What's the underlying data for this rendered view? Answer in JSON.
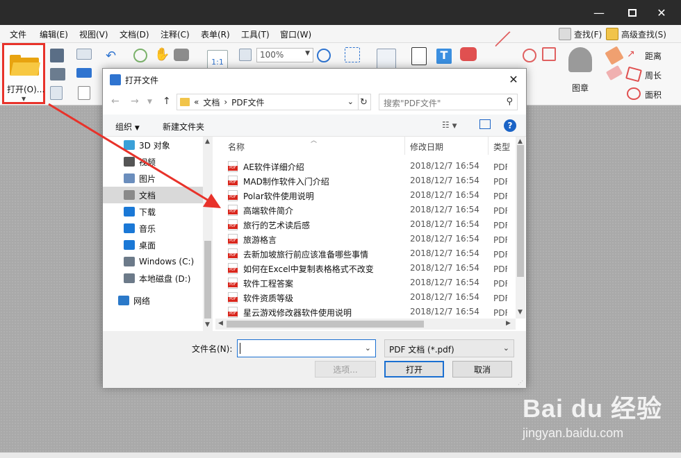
{
  "menu": {
    "items": [
      "文件",
      "编辑(E)",
      "视图(V)",
      "文档(D)",
      "注释(C)",
      "表单(R)",
      "工具(T)",
      "窗口(W)"
    ],
    "search": "查找(F)",
    "advanced_search": "高级查找(S)"
  },
  "ribbon": {
    "open_label": "打开(O)...",
    "zoom_value": "100%",
    "stamp_label": "图章",
    "distance_label": "距离",
    "perimeter_label": "周长",
    "area_label": "面积"
  },
  "dialog": {
    "title": "打开文件",
    "close": "✕",
    "address": {
      "prefix": "«",
      "crumb1": "文档",
      "sep": "›",
      "crumb2": "PDF文件"
    },
    "search_placeholder": "搜索\"PDF文件\"",
    "commands": {
      "organize": "组织",
      "new_folder": "新建文件夹"
    },
    "nav_items": [
      {
        "label": "3D 对象",
        "icon": "3d-objects-icon",
        "color": "#3aa0d8"
      },
      {
        "label": "视频",
        "icon": "video-icon",
        "color": "#555555"
      },
      {
        "label": "图片",
        "icon": "pictures-icon",
        "color": "#6b8ebd"
      },
      {
        "label": "文档",
        "icon": "documents-icon",
        "color": "#8a8a8a",
        "selected": true
      },
      {
        "label": "下载",
        "icon": "download-icon",
        "color": "#1a78d6"
      },
      {
        "label": "音乐",
        "icon": "music-icon",
        "color": "#1a78d6"
      },
      {
        "label": "桌面",
        "icon": "desktop-icon",
        "color": "#1a78d6"
      },
      {
        "label": "Windows (C:)",
        "icon": "drive-c-icon",
        "color": "#6c7a89"
      },
      {
        "label": "本地磁盘 (D:)",
        "icon": "drive-d-icon",
        "color": "#6c7a89"
      },
      {
        "label": "网络",
        "icon": "network-icon",
        "color": "#2b79c9"
      }
    ],
    "columns": {
      "name": "名称",
      "date": "修改日期",
      "type": "类型"
    },
    "files": [
      {
        "name": "AE软件详细介绍",
        "date": "2018/12/7 16:54",
        "type": "PDF 文"
      },
      {
        "name": "MAD制作软件入门介绍",
        "date": "2018/12/7 16:54",
        "type": "PDF 文"
      },
      {
        "name": "Polar软件使用说明",
        "date": "2018/12/7 16:54",
        "type": "PDF 文"
      },
      {
        "name": "高端软件简介",
        "date": "2018/12/7 16:54",
        "type": "PDF 文"
      },
      {
        "name": "旅行的艺术读后感",
        "date": "2018/12/7 16:54",
        "type": "PDF 文"
      },
      {
        "name": "旅游格言",
        "date": "2018/12/7 16:54",
        "type": "PDF 文"
      },
      {
        "name": "去新加坡旅行前应该准备哪些事情",
        "date": "2018/12/7 16:54",
        "type": "PDF 文"
      },
      {
        "name": "如何在Excel中复制表格格式不改变",
        "date": "2018/12/7 16:54",
        "type": "PDF 文"
      },
      {
        "name": "软件工程答案",
        "date": "2018/12/7 16:54",
        "type": "PDF 文"
      },
      {
        "name": "软件资质等级",
        "date": "2018/12/7 16:54",
        "type": "PDF 文"
      },
      {
        "name": "星云游戏修改器软件使用说明",
        "date": "2018/12/7 16:54",
        "type": "PDF 文"
      }
    ],
    "filename_label": "文件名(N):",
    "filename_value": "",
    "filetype_value": "PDF 文档 (*.pdf)",
    "options_button": "选项...",
    "open_button": "打开",
    "cancel_button": "取消"
  },
  "watermark": {
    "logo": "Bai du 经验",
    "url": "jingyan.baidu.com"
  },
  "colors": {
    "highlight_red": "#e8322a",
    "accent_blue": "#1a6fd1",
    "folder_yellow": "#f1c44a"
  }
}
